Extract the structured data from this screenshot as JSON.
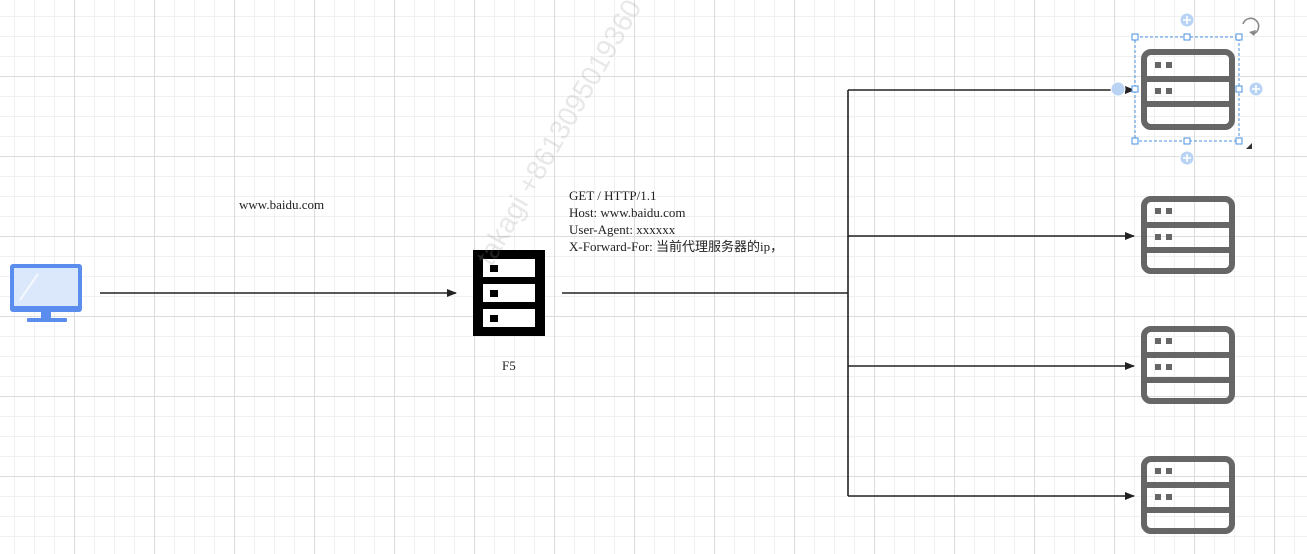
{
  "diagram": {
    "domain_label": "www.baidu.com",
    "proxy_label": "F5",
    "request_lines": [
      "GET / HTTP/1.1",
      "Host: www.baidu.com",
      "User-Agent: xxxxxx",
      "X-Forward-For: 当前代理服务器的ip，"
    ],
    "watermark": "takagi +8613095019360",
    "nodes": {
      "client": {
        "icon": "monitor-icon",
        "color": "#5b8def"
      },
      "proxy": {
        "icon": "server-icon",
        "color": "#000000"
      },
      "backends": [
        {
          "icon": "server-icon",
          "color": "#666666",
          "selected": true
        },
        {
          "icon": "server-icon",
          "color": "#666666",
          "selected": false
        },
        {
          "icon": "server-icon",
          "color": "#666666",
          "selected": false
        },
        {
          "icon": "server-icon",
          "color": "#666666",
          "selected": false
        }
      ]
    },
    "colors": {
      "edge": "#222222",
      "selection": "#4a90e2"
    }
  }
}
